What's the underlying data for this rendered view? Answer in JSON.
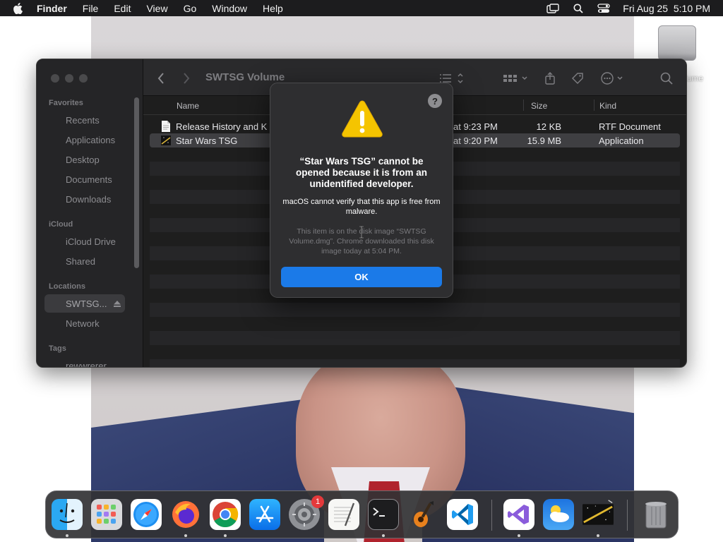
{
  "menubar": {
    "app_name": "Finder",
    "menus": [
      "File",
      "Edit",
      "View",
      "Go",
      "Window",
      "Help"
    ],
    "datetime": "Fri Aug 25  5:10 PM"
  },
  "desktop": {
    "drive_label_fragment": "lume"
  },
  "finder": {
    "title": "SWTSG Volume",
    "sidebar": {
      "favorites_header": "Favorites",
      "favorites": [
        "Recents",
        "Applications",
        "Desktop",
        "Documents",
        "Downloads"
      ],
      "icloud_header": "iCloud",
      "icloud": [
        "iCloud Drive",
        "Shared"
      ],
      "locations_header": "Locations",
      "locations": [
        "SWTSG...",
        "Network"
      ],
      "tags_header": "Tags",
      "tags": [
        "rewwrerer"
      ]
    },
    "columns": {
      "name": "Name",
      "size": "Size",
      "kind": "Kind"
    },
    "files": [
      {
        "name": "Release History and K",
        "date": "at 9:23 PM",
        "size": "12 KB",
        "kind": "RTF Document"
      },
      {
        "name": "Star Wars TSG",
        "date": "at 9:20 PM",
        "size": "15.9 MB",
        "kind": "Application"
      }
    ]
  },
  "alert": {
    "help_label": "?",
    "title": "“Star Wars TSG” cannot be opened because it is from an unidentified developer.",
    "message": "macOS cannot verify that this app is free from malware.",
    "info": "This item is on the disk image “SWTSG Volume.dmg”. Chrome downloaded this disk image today at 5:04 PM.",
    "ok_label": "OK"
  },
  "dock": {
    "apps": [
      "Finder",
      "Launchpad",
      "Safari",
      "Firefox",
      "Chrome",
      "App Store",
      "System Settings",
      "TextEdit",
      "Terminal",
      "GarageBand",
      "Visual Studio Code",
      "Visual Studio",
      "Weather",
      "Star Wars TSG",
      "Trash"
    ],
    "settings_badge": "1"
  }
}
